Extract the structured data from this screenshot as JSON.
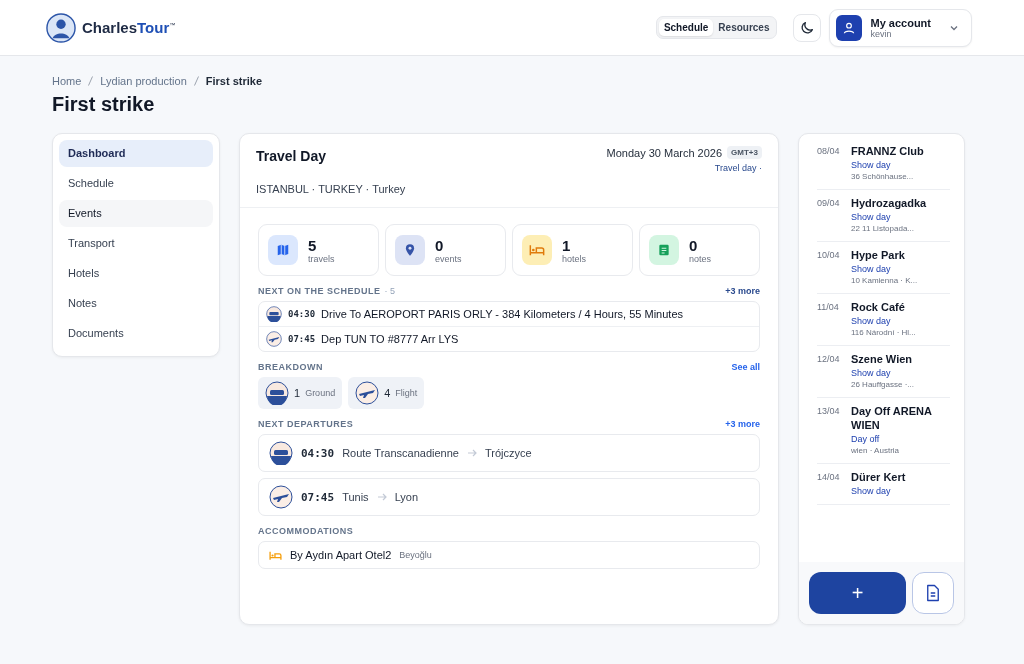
{
  "header": {
    "brand": {
      "name": "Charles",
      "accent": "Tour",
      "mark": "™"
    },
    "toggle": [
      {
        "label": "Schedule",
        "selected": true
      },
      {
        "label": "Resources",
        "selected": false
      }
    ],
    "account": {
      "title": "My account",
      "user": "kevin"
    }
  },
  "breadcrumb": [
    "Home",
    "Lydian production",
    "First strike"
  ],
  "page_title": "First strike",
  "sidebar": {
    "items": [
      {
        "label": "Dashboard",
        "selected": true,
        "hovered": false
      },
      {
        "label": "Schedule",
        "selected": false,
        "hovered": false
      },
      {
        "label": "Events",
        "selected": false,
        "hovered": true
      },
      {
        "label": "Transport",
        "selected": false,
        "hovered": false
      },
      {
        "label": "Hotels",
        "selected": false,
        "hovered": false
      },
      {
        "label": "Notes",
        "selected": false,
        "hovered": false
      },
      {
        "label": "Documents",
        "selected": false,
        "hovered": false
      }
    ]
  },
  "day": {
    "title": "Travel Day",
    "date": "Monday 30 March 2026",
    "tz": "GMT+3",
    "type_link": "Travel day ·",
    "location": "ISTANBUL · TURKEY · Turkey",
    "stats": [
      {
        "kind": "travels",
        "value": "5",
        "label": "travels"
      },
      {
        "kind": "events",
        "value": "0",
        "label": "events"
      },
      {
        "kind": "hotels",
        "value": "1",
        "label": "hotels"
      },
      {
        "kind": "notes",
        "value": "0",
        "label": "notes"
      }
    ],
    "schedule": {
      "title": "NEXT ON THE SCHEDULE",
      "count": "· 5",
      "more": "+3 more",
      "items": [
        {
          "kind": "ground",
          "time": "04:30",
          "text": "Drive To AEROPORT PARIS ORLY - 384 Kilometers / 4 Hours, 55 Minutes"
        },
        {
          "kind": "flight",
          "time": "07:45",
          "text": "Dep TUN TO #8777 Arr LYS"
        }
      ]
    },
    "breakdown": {
      "title": "BREAKDOWN",
      "link": "See all",
      "items": [
        {
          "kind": "ground",
          "count": "1",
          "label": "Ground"
        },
        {
          "kind": "flight",
          "count": "4",
          "label": "Flight"
        }
      ]
    },
    "departures": {
      "title": "NEXT DEPARTURES",
      "more": "+3 more",
      "items": [
        {
          "kind": "ground",
          "time": "04:30",
          "from": "Route Transcanadienne",
          "to": "Trójczyce"
        },
        {
          "kind": "flight",
          "time": "07:45",
          "from": "Tunis",
          "to": "Lyon"
        }
      ]
    },
    "accommodations": {
      "title": "ACCOMMODATIONS",
      "items": [
        {
          "name": "By Aydın Apart Otel2",
          "area": "Beyoğlu"
        }
      ]
    }
  },
  "upcoming": [
    {
      "date": "08/04",
      "title": "FRANNZ Club",
      "link": "Show day",
      "address": "36 Schönhause..."
    },
    {
      "date": "09/04",
      "title": "Hydrozagadka",
      "link": "Show day",
      "address": "22 11 Listopada..."
    },
    {
      "date": "10/04",
      "title": "Hype Park",
      "link": "Show day",
      "address": "10 Kamienna · K..."
    },
    {
      "date": "11/04",
      "title": "Rock Café",
      "link": "Show day",
      "address": "116 Národní · Hl..."
    },
    {
      "date": "12/04",
      "title": "Szene Wien",
      "link": "Show day",
      "address": "26 Hauffgasse ·..."
    },
    {
      "date": "13/04",
      "title": "Day Off ARENA WIEN",
      "link": "Day off",
      "address": "wien · Austria"
    },
    {
      "date": "14/04",
      "title": "Dürer Kert",
      "link": "Show day"
    }
  ],
  "actions": {
    "add": "+"
  }
}
